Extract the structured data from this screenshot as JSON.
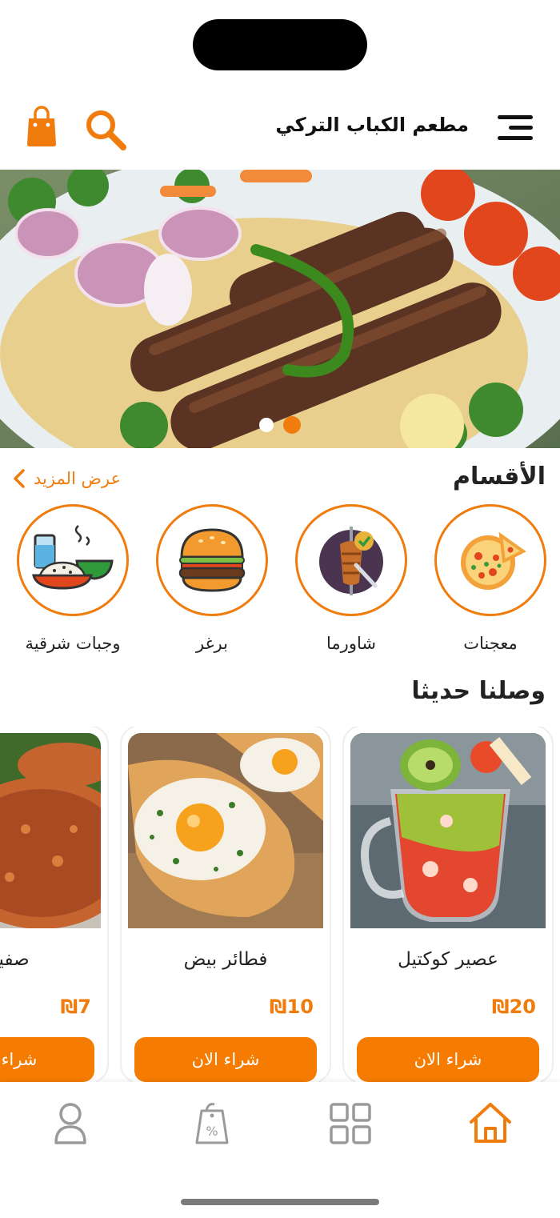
{
  "header": {
    "title": "مطعم الكباب التركي",
    "icons": [
      "menu-icon",
      "search-icon",
      "shopping-bag-icon"
    ]
  },
  "banner": {
    "slides": 2,
    "active_slide": 2
  },
  "categories": {
    "title": "الأقسام",
    "more_label": "عرض المزيد",
    "items": [
      {
        "label": "معجنات",
        "icon": "pizza-icon"
      },
      {
        "label": "شاورما",
        "icon": "shawarma-icon"
      },
      {
        "label": "برغر",
        "icon": "burger-icon"
      },
      {
        "label": "وجبات شرقية",
        "icon": "oriental-meal-icon"
      }
    ]
  },
  "new_arrivals": {
    "title": "وصلنا حديثا",
    "items": [
      {
        "name": "عصير كوكتيل",
        "price": "₪20",
        "button": "شراء الان"
      },
      {
        "name": "فطائر بيض",
        "price": "₪10",
        "button": "شراء الان"
      },
      {
        "name": "صفيحة",
        "price": "₪7",
        "button": "شراء الان"
      }
    ]
  },
  "bottom_nav": {
    "tabs": [
      "home-icon",
      "grid-icon",
      "discount-tag-icon",
      "user-icon"
    ],
    "active": "home-icon"
  },
  "colors": {
    "accent": "#f07c0e",
    "button": "#f57c00",
    "inactive_icon": "#9a9a9a"
  }
}
